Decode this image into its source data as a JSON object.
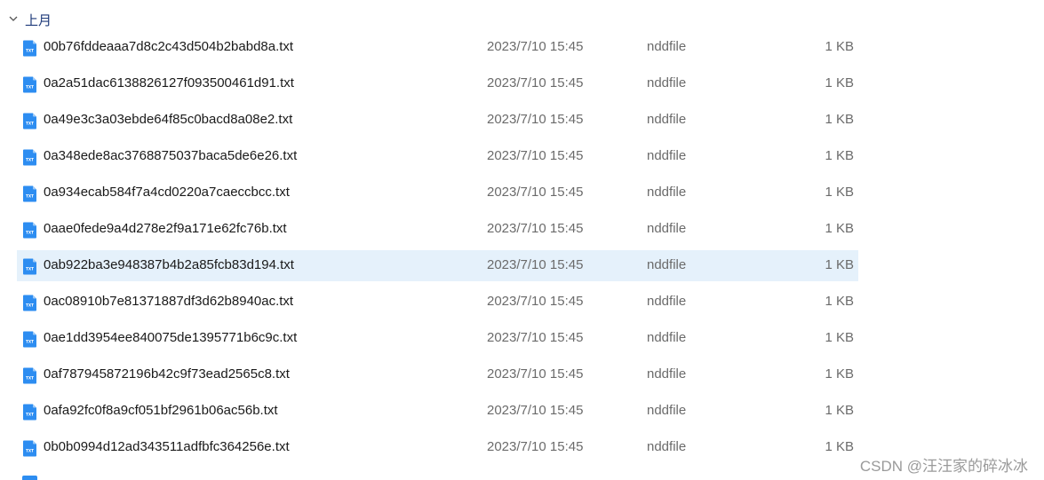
{
  "group": {
    "label": "上月"
  },
  "icon_text": "TXT",
  "files": [
    {
      "name": "00b76fddeaaa7d8c2c43d504b2babd8a.txt",
      "date": "2023/7/10 15:45",
      "type": "nddfile",
      "size": "1 KB",
      "selected": false
    },
    {
      "name": "0a2a51dac6138826127f093500461d91.txt",
      "date": "2023/7/10 15:45",
      "type": "nddfile",
      "size": "1 KB",
      "selected": false
    },
    {
      "name": "0a49e3c3a03ebde64f85c0bacd8a08e2.txt",
      "date": "2023/7/10 15:45",
      "type": "nddfile",
      "size": "1 KB",
      "selected": false
    },
    {
      "name": "0a348ede8ac3768875037baca5de6e26.txt",
      "date": "2023/7/10 15:45",
      "type": "nddfile",
      "size": "1 KB",
      "selected": false
    },
    {
      "name": "0a934ecab584f7a4cd0220a7caeccbcc.txt",
      "date": "2023/7/10 15:45",
      "type": "nddfile",
      "size": "1 KB",
      "selected": false
    },
    {
      "name": "0aae0fede9a4d278e2f9a171e62fc76b.txt",
      "date": "2023/7/10 15:45",
      "type": "nddfile",
      "size": "1 KB",
      "selected": false
    },
    {
      "name": "0ab922ba3e948387b4b2a85fcb83d194.txt",
      "date": "2023/7/10 15:45",
      "type": "nddfile",
      "size": "1 KB",
      "selected": true
    },
    {
      "name": "0ac08910b7e81371887df3d62b8940ac.txt",
      "date": "2023/7/10 15:45",
      "type": "nddfile",
      "size": "1 KB",
      "selected": false
    },
    {
      "name": "0ae1dd3954ee840075de1395771b6c9c.txt",
      "date": "2023/7/10 15:45",
      "type": "nddfile",
      "size": "1 KB",
      "selected": false
    },
    {
      "name": "0af787945872196b42c9f73ead2565c8.txt",
      "date": "2023/7/10 15:45",
      "type": "nddfile",
      "size": "1 KB",
      "selected": false
    },
    {
      "name": "0afa92fc0f8a9cf051bf2961b06ac56b.txt",
      "date": "2023/7/10 15:45",
      "type": "nddfile",
      "size": "1 KB",
      "selected": false
    },
    {
      "name": "0b0b0994d12ad343511adfbfc364256e.txt",
      "date": "2023/7/10 15:45",
      "type": "nddfile",
      "size": "1 KB",
      "selected": false
    }
  ],
  "watermark": "CSDN @汪汪家的碎冰冰",
  "colors": {
    "selected_row": "#e5f1fb",
    "icon_blue": "#2d8df1",
    "group_label": "#1e3a7a"
  }
}
